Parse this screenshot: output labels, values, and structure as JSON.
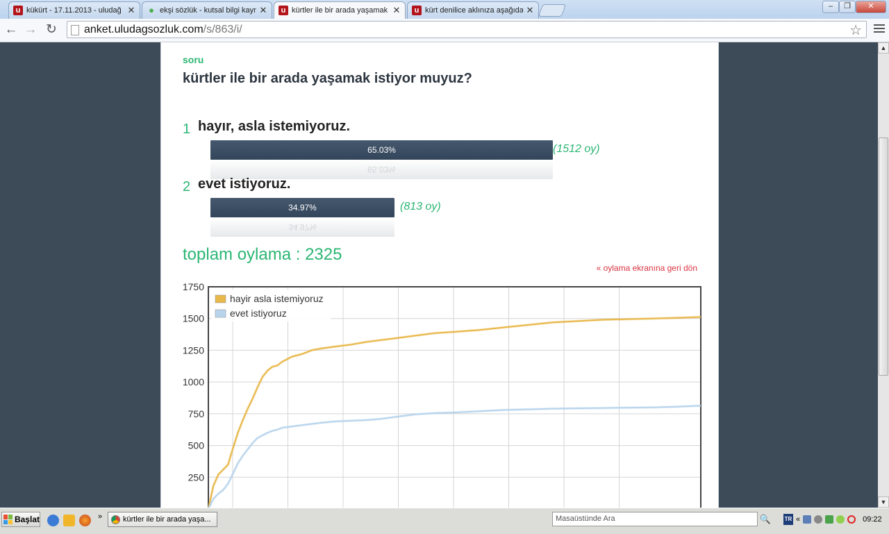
{
  "browser": {
    "tabs": [
      {
        "label": "kükürt - 17.11.2013 - uludağ",
        "icon": "uludag-favicon",
        "active": false
      },
      {
        "label": "ekşi sözlük - kutsal bilgi kayna",
        "icon": "eksi-favicon",
        "active": false
      },
      {
        "label": "kürtler ile bir arada yaşamak",
        "icon": "uludag-favicon",
        "active": true
      },
      {
        "label": "kürt denilice aklınıza aşağıdak",
        "icon": "uludag-favicon",
        "active": false
      }
    ],
    "favicon_letter": "u",
    "close_glyph": "✕",
    "url_host": "anket.uludagsozluk.com",
    "url_path": "/s/863/i/",
    "back_glyph": "←",
    "forward_glyph": "→",
    "reload_glyph": "↻",
    "star_glyph": "☆",
    "window_buttons": [
      "‒",
      "❐",
      "✕"
    ]
  },
  "poll": {
    "label": "soru",
    "question": "kürtler ile bir arada yaşamak istiyor muyuz?",
    "options": [
      {
        "num": "1",
        "text": "hayır, asla istemiyoruz.",
        "percent": "65.03%",
        "fraction": 0.6503,
        "votes": "(1512 oy)"
      },
      {
        "num": "2",
        "text": "evet istiyoruz.",
        "percent": "34.97%",
        "fraction": 0.3497,
        "votes": "(813 oy)"
      }
    ],
    "total": "toplam oylama : 2325",
    "back_link": "« oylama ekranına geri dön"
  },
  "chart_data": {
    "type": "line",
    "ylim": [
      0,
      1750
    ],
    "y_ticks": [
      250,
      500,
      750,
      1000,
      1250,
      1500,
      1750
    ],
    "xlim": [
      0,
      100
    ],
    "legend_position": "top-left",
    "grid": true,
    "colors": {
      "series1": "#e8b84b",
      "series2": "#b8d4ec"
    },
    "series": [
      {
        "name": "hayir asla istemiyoruz",
        "x": [
          0,
          1,
          2,
          3,
          4,
          5,
          6,
          7,
          8,
          9,
          10,
          11,
          12,
          13,
          14,
          15,
          17,
          19,
          21,
          23,
          26,
          29,
          32,
          35,
          38,
          42,
          46,
          50,
          55,
          60,
          65,
          70,
          75,
          80,
          85,
          90,
          95,
          100
        ],
        "y": [
          0,
          180,
          270,
          310,
          350,
          480,
          600,
          700,
          790,
          870,
          960,
          1040,
          1090,
          1120,
          1130,
          1160,
          1200,
          1220,
          1250,
          1265,
          1280,
          1295,
          1315,
          1330,
          1345,
          1365,
          1385,
          1395,
          1410,
          1430,
          1450,
          1470,
          1480,
          1490,
          1495,
          1500,
          1505,
          1512
        ]
      },
      {
        "name": "evet istiyoruz",
        "x": [
          0,
          1,
          2,
          3,
          4,
          5,
          6,
          7,
          8,
          9,
          10,
          11,
          12,
          13,
          14,
          15,
          17,
          19,
          21,
          23,
          26,
          29,
          32,
          35,
          38,
          42,
          46,
          50,
          55,
          60,
          65,
          70,
          75,
          80,
          85,
          90,
          95,
          100
        ],
        "y": [
          0,
          80,
          120,
          150,
          200,
          280,
          360,
          420,
          470,
          520,
          560,
          580,
          600,
          615,
          625,
          640,
          650,
          660,
          670,
          680,
          690,
          695,
          700,
          710,
          725,
          745,
          755,
          760,
          770,
          780,
          785,
          790,
          793,
          795,
          798,
          800,
          805,
          813
        ]
      }
    ]
  },
  "taskbar": {
    "start": "Başlat",
    "task": "kürtler ile bir arada yaşa...",
    "overflow": "»",
    "search_placeholder": "Masaüstünde Ara",
    "search_glyph": "🔍",
    "lang": "TR",
    "tray_chevron": "«",
    "clock": "09:22"
  }
}
